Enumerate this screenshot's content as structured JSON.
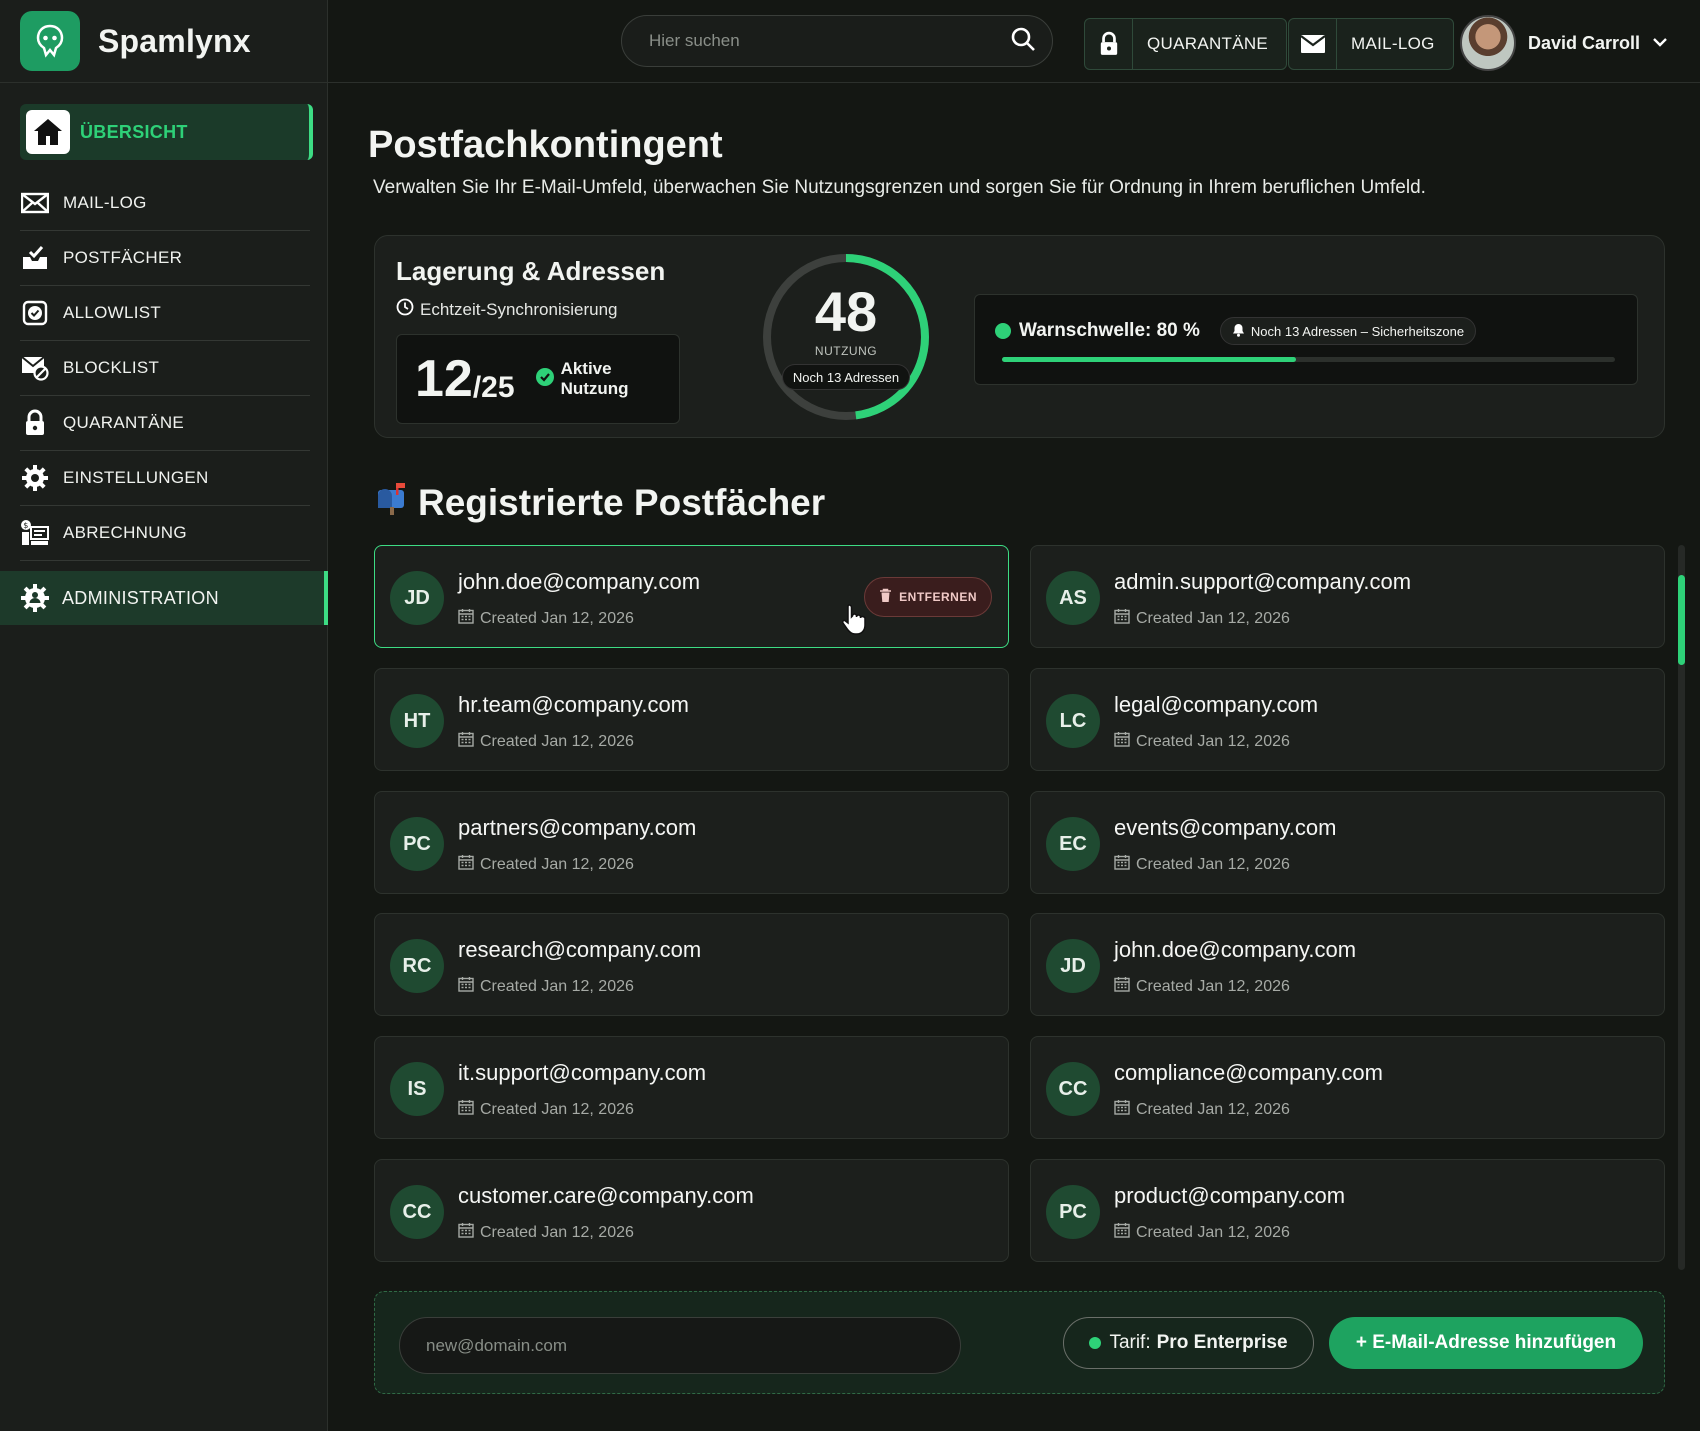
{
  "brand": {
    "name": "Spamlynx"
  },
  "sidebar": {
    "active_item": "ÜBERSICHT",
    "items": [
      {
        "label": "MAIL-LOG",
        "icon": "mail-x-icon"
      },
      {
        "label": "POSTFÄCHER",
        "icon": "inbox-icon"
      },
      {
        "label": "ALLOWLIST",
        "icon": "check-square-icon"
      },
      {
        "label": "BLOCKLIST",
        "icon": "mail-block-icon"
      },
      {
        "label": "QUARANTÄNE",
        "icon": "lock-icon"
      },
      {
        "label": "EINSTELLUNGEN",
        "icon": "gear-icon"
      },
      {
        "label": "ABRECHNUNG",
        "icon": "billing-icon"
      }
    ],
    "admin_label": "ADMINISTRATION"
  },
  "header": {
    "search_placeholder": "Hier suchen",
    "quarantine_label": "QUARANTÄNE",
    "maillog_label": "MAIL-LOG",
    "user_name": "David Carroll"
  },
  "page": {
    "title": "Postfachkontingent",
    "subtitle": "Verwalten Sie Ihr E-Mail-Umfeld, überwachen Sie Nutzungsgrenzen und sorgen Sie für Ordnung in Ihrem beruflichen Umfeld."
  },
  "stats": {
    "heading": "Lagerung & Adressen",
    "sync_label": "Echtzeit-Synchronisierung",
    "used": "12",
    "limit": "/25",
    "active_label": "Aktive Nutzung",
    "gauge_value": "48",
    "gauge_fraction": 0.48,
    "gauge_label": "NUTZUNG",
    "gauge_pill": "Noch 13 Adressen",
    "warn_label": "Warnschwelle: 80 %",
    "warn_pill": "Noch 13 Adressen – Sicherheitszone",
    "warn_fill_fraction": 0.48
  },
  "section": {
    "title": "Registrierte Postfächer",
    "icon": "mailbox-icon"
  },
  "remove_label": "ENTFERNEN",
  "mailboxes": [
    {
      "initials": "JD",
      "email": "john.doe@company.com",
      "created": "Created Jan 12, 2026"
    },
    {
      "initials": "AS",
      "email": "admin.support@company.com",
      "created": "Created Jan 12, 2026"
    },
    {
      "initials": "HT",
      "email": "hr.team@company.com",
      "created": "Created Jan 12, 2026"
    },
    {
      "initials": "LC",
      "email": "legal@company.com",
      "created": "Created Jan 12, 2026"
    },
    {
      "initials": "PC",
      "email": "partners@company.com",
      "created": "Created Jan 12, 2026"
    },
    {
      "initials": "EC",
      "email": "events@company.com",
      "created": "Created Jan 12, 2026"
    },
    {
      "initials": "RC",
      "email": "research@company.com",
      "created": "Created Jan 12, 2026"
    },
    {
      "initials": "JD",
      "email": "john.doe@company.com",
      "created": "Created Jan 12, 2026"
    },
    {
      "initials": "IS",
      "email": "it.support@company.com",
      "created": "Created Jan 12, 2026"
    },
    {
      "initials": "CC",
      "email": "compliance@company.com",
      "created": "Created Jan 12, 2026"
    },
    {
      "initials": "CC",
      "email": "customer.care@company.com",
      "created": "Created Jan 12, 2026"
    },
    {
      "initials": "PC",
      "email": "product@company.com",
      "created": "Created Jan 12, 2026"
    }
  ],
  "add": {
    "placeholder": "new@domain.com",
    "plan_prefix": "Tarif:",
    "plan_name": "Pro Enterprise",
    "button_label": "+ E-Mail-Adresse hinzufügen"
  },
  "colors": {
    "accent": "#2ed178",
    "brand": "#1e9c62",
    "background": "#141713"
  }
}
